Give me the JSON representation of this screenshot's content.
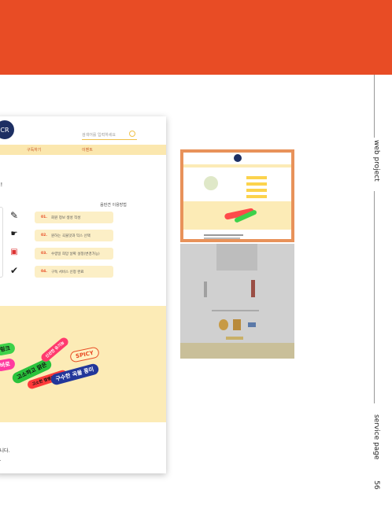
{
  "colors": {
    "top_band": "#e84c25",
    "accent_yellow": "#fcebb6",
    "nav_yellow": "#fbe7ae",
    "highlight_border": "#e8925a"
  },
  "mockup": {
    "logo_text": "CR",
    "search_placeholder": "검색어를 입력하세요",
    "nav": [
      "구독하기",
      "이벤트"
    ],
    "question_tail": "요!",
    "process_title": "음판견 이용방법",
    "steps": [
      {
        "num": "01.",
        "text": "회원 정보 생성 작성",
        "icon": "pencil-icon"
      },
      {
        "num": "02.",
        "text": "원하는 곡물맛과 믹스 선택",
        "icon": "hand-icon"
      },
      {
        "num": "03.",
        "text": "수령일 희망 날짜 설정(변경가능)",
        "icon": "calendar-icon"
      },
      {
        "num": "04.",
        "text": "구독 서비스 신청 완료",
        "icon": "check-icon"
      }
    ],
    "stickers": [
      "링크",
      "바로",
      "고소하고 맑은",
      "고소한 캠벨의 단맛",
      "SPICY",
      "구수한 곡물 풍미",
      "신선한 유기농"
    ],
    "footer_lines": [
      "습니다.",
      "요."
    ]
  },
  "side_labels": {
    "top": "web project",
    "bottom": "service page",
    "page_number": "56"
  }
}
